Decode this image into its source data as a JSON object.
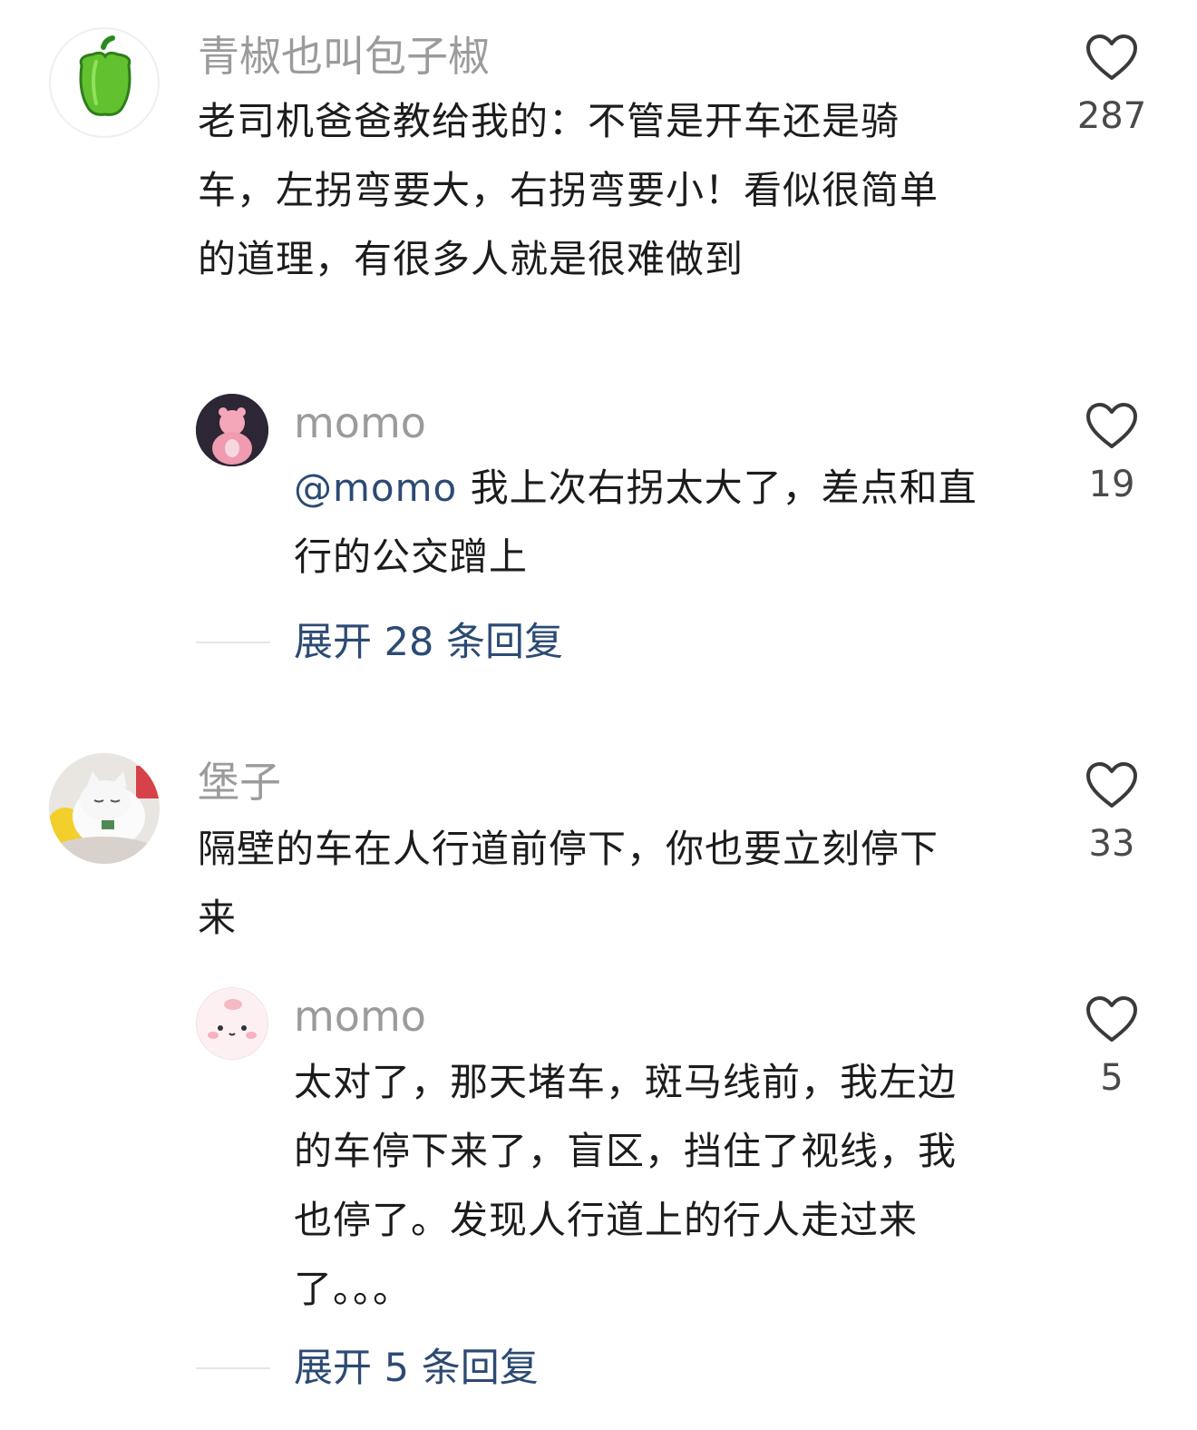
{
  "comments": [
    {
      "username": "青椒也叫包子椒",
      "avatar_icon": "green-pepper-icon",
      "text_lines": [
        "老司机爸爸教给我的：不管是开车还是骑",
        "车，左拐弯要大，右拐弯要小！看似很简单",
        "的道理，有很多人就是很难做到"
      ],
      "likes": "287",
      "reply": {
        "username": "momo",
        "avatar_icon": "pink-bear-avatar-icon",
        "mention": "@momo",
        "text_lines": [
          " 我上次右拐太大了，差点和直",
          "行的公交蹭上"
        ],
        "likes": "19"
      },
      "expand_label": "展开 28 条回复"
    },
    {
      "username": "堡子",
      "avatar_icon": "cat-avatar-icon",
      "text_lines": [
        "隔壁的车在人行道前停下，你也要立刻停下",
        "来"
      ],
      "likes": "33",
      "reply": {
        "username": "momo",
        "avatar_icon": "cute-face-avatar-icon",
        "text_lines": [
          "太对了，那天堵车，斑马线前，我左边",
          "的车停下来了，盲区，挡住了视线，我",
          "也停了。发现人行道上的行人走过来",
          "了。。。"
        ],
        "likes": "5"
      },
      "expand_label": "展开 5 条回复"
    }
  ]
}
